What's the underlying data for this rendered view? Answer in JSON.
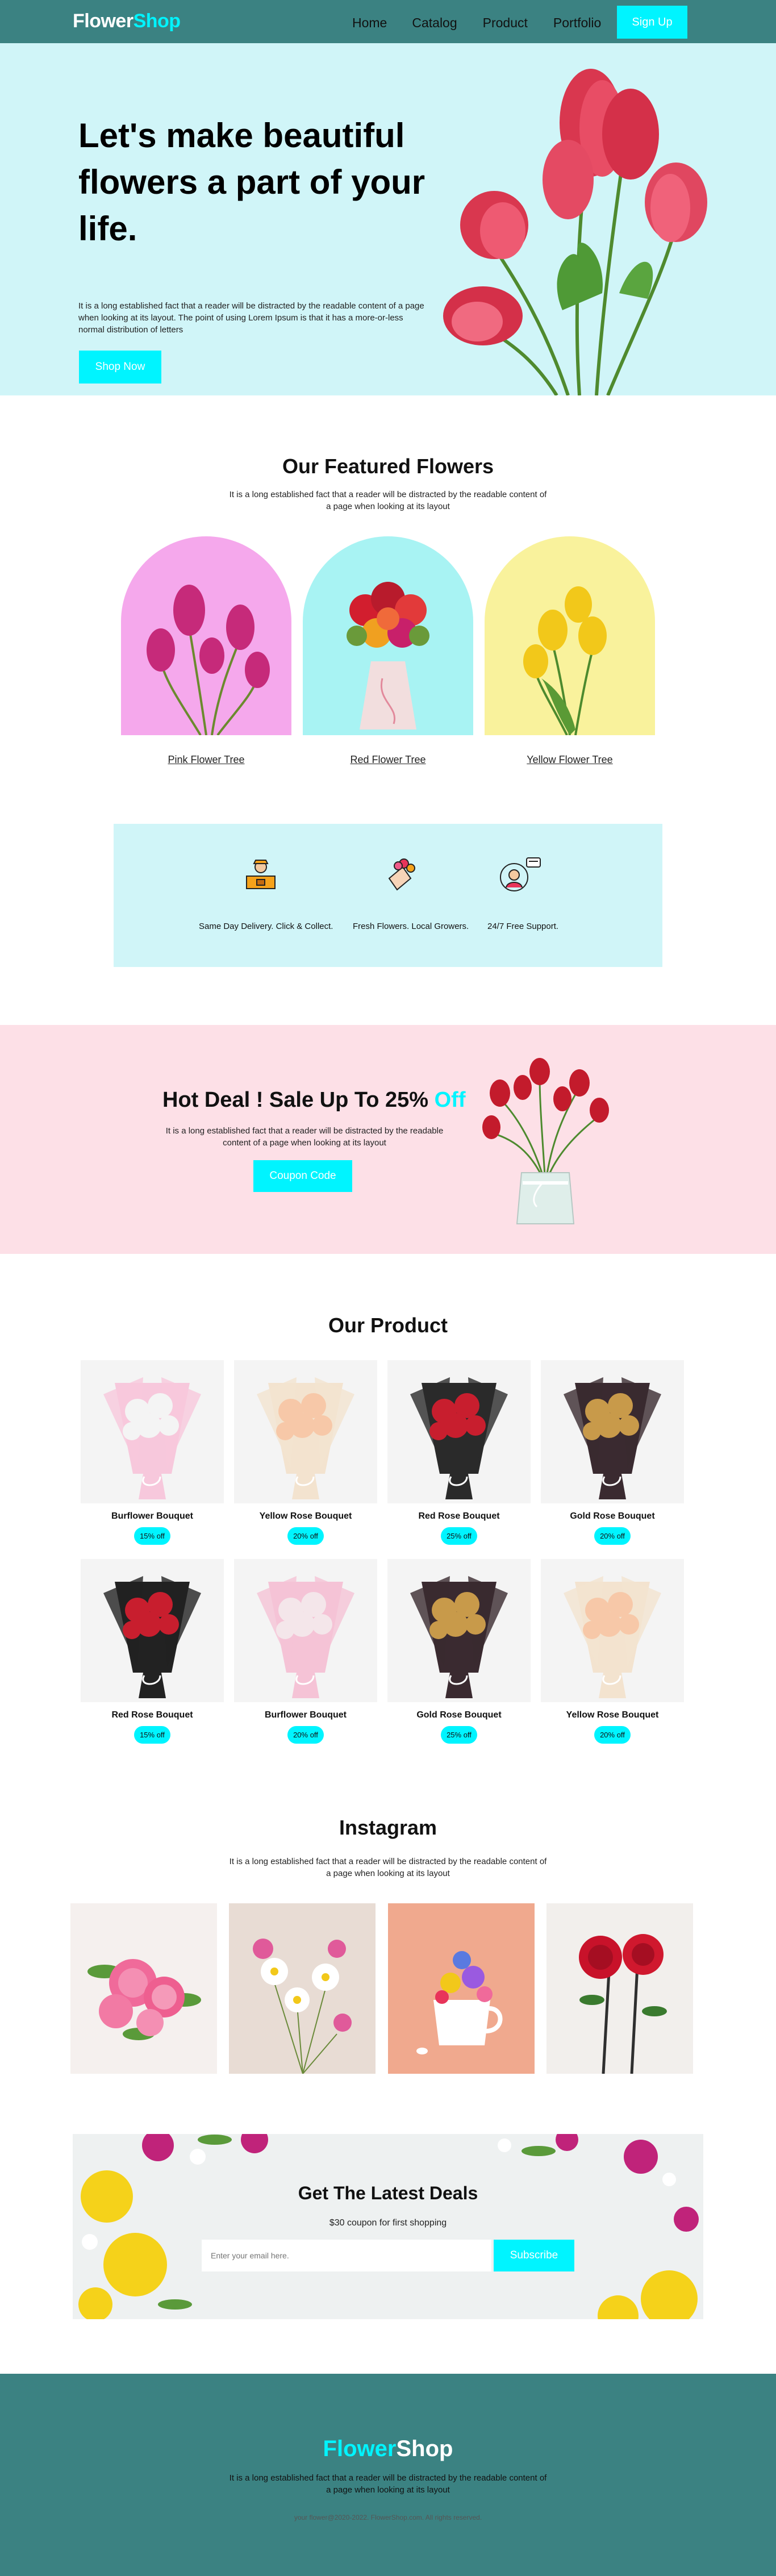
{
  "nav": {
    "logo_part1": "Flower",
    "logo_part2": "Shop",
    "links": [
      "Home",
      "Catalog",
      "Product",
      "Portfolio"
    ],
    "signup_label": "Sign Up"
  },
  "hero": {
    "headline": "Let's make beautiful flowers a part of your life.",
    "body": "It is a long established fact that a reader will be distracted by the readable content of a page when looking at its layout. The point of using Lorem Ipsum is that it has a more-or-less normal distribution of letters",
    "cta_label": "Shop Now",
    "bg_color": "#d0f5f8"
  },
  "featured": {
    "title": "Our Featured Flowers",
    "subtitle": "It is a long established fact that a reader will be distracted by the readable content of a page when looking at its layout",
    "items": [
      {
        "label": "Pink Flower Tree",
        "bg": "#f5a8ec"
      },
      {
        "label": "Red Flower Tree",
        "bg": "#a8f3f3"
      },
      {
        "label": "Yellow Flower Tree",
        "bg": "#f9f29c"
      }
    ]
  },
  "features": {
    "items": [
      {
        "icon": "delivery-person-icon",
        "text": "Same Day Delivery. Click & Collect."
      },
      {
        "icon": "bouquet-icon",
        "text": "Fresh Flowers. Local Growers."
      },
      {
        "icon": "support-phone-icon",
        "text": "24/7 Free Support."
      }
    ]
  },
  "deal": {
    "title_main": "Hot Deal ! Sale Up To 25% ",
    "title_accent": "Off",
    "body": "It is a long established fact that a reader will be distracted by the readable content of a page when looking at its layout",
    "cta_label": "Coupon Code"
  },
  "products": {
    "title": "Our Product",
    "items": [
      {
        "name": "Burflower Bouquet",
        "badge": "15% off",
        "wrap": "#f7c8dc",
        "flowers": "#f4f4f4"
      },
      {
        "name": "Yellow Rose Bouquet",
        "badge": "20% off",
        "wrap": "#f3e3cf",
        "flowers": "#f7c8a8"
      },
      {
        "name": "Red Rose Bouquet",
        "badge": "25% off",
        "wrap": "#2a2a2a",
        "flowers": "#c81e2e"
      },
      {
        "name": "Gold Rose Bouquet",
        "badge": "20% off",
        "wrap": "#3a2a30",
        "flowers": "#c89a4a"
      },
      {
        "name": "Red Rose Bouquet",
        "badge": "15% off",
        "wrap": "#222222",
        "flowers": "#c81e2e"
      },
      {
        "name": "Burflower Bouquet",
        "badge": "20% off",
        "wrap": "#f5c3d6",
        "flowers": "#f4e6ea"
      },
      {
        "name": "Gold Rose Bouquet",
        "badge": "25% off",
        "wrap": "#3a2a30",
        "flowers": "#c89a4a"
      },
      {
        "name": "Yellow Rose Bouquet",
        "badge": "20% off",
        "wrap": "#f3e3cf",
        "flowers": "#f7c8a8"
      }
    ]
  },
  "instagram": {
    "title": "Instagram",
    "subtitle": "It is a long established fact that a reader will be distracted by the readable content of a page when looking at its layout",
    "images": [
      "pink-roses",
      "wildflowers",
      "flower-cup",
      "red-roses"
    ]
  },
  "newsletter": {
    "title": "Get The Latest Deals",
    "subtitle": "$30 coupon for first shopping",
    "placeholder": "Enter your email here.",
    "button_label": "Subscribe"
  },
  "footer": {
    "logo_part1": "Flower",
    "logo_part2": "Shop",
    "text": "It is a long established fact that a reader will be distracted by the readable content of a page when looking at its layout",
    "copyright": "your flower@2020-2022. FlowerShop.com. All rights reserved."
  },
  "colors": {
    "accent": "#00f4ff",
    "teal": "#3b8282",
    "pink_bg": "#fde0e7"
  }
}
